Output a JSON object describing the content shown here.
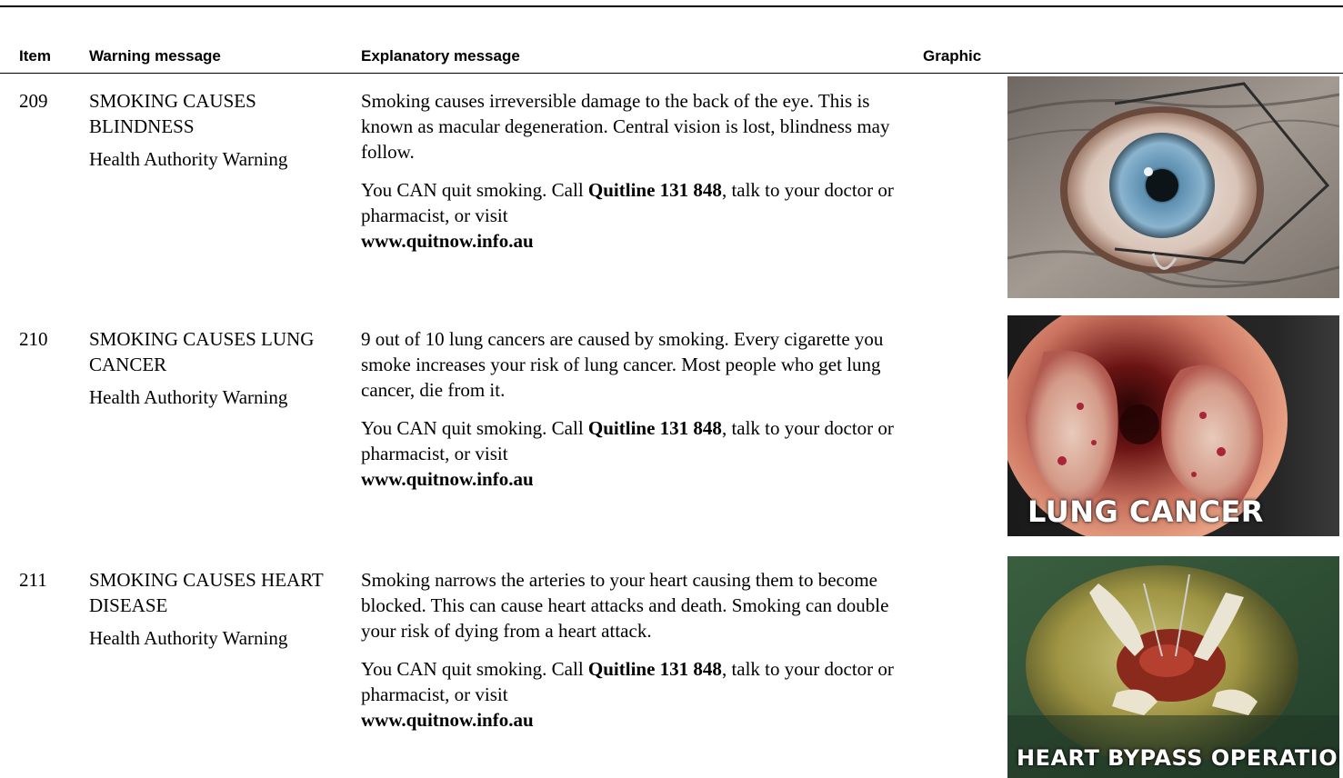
{
  "columns": {
    "item": "Item",
    "warning": "Warning message",
    "explanatory": "Explanatory message",
    "graphic": "Graphic"
  },
  "rows": [
    {
      "item": "209",
      "warning": "SMOKING CAUSES BLINDNESS",
      "authority": "Health Authority Warning",
      "explanation": "Smoking causes irreversible damage to the back of the eye. This is known as macular degeneration. Central vision is lost, blindness may follow.",
      "quit_prefix": "You CAN quit smoking. Call ",
      "quitline": "Quitline 131 848",
      "quit_suffix": ", talk to your doctor or pharmacist, or visit",
      "url": "www.quitnow.info.au",
      "graphic_caption": ""
    },
    {
      "item": "210",
      "warning": "SMOKING CAUSES LUNG CANCER",
      "authority": "Health Authority Warning",
      "explanation": "9 out of 10 lung cancers are caused by smoking. Every cigarette you smoke increases your risk of lung cancer. Most people who get lung cancer, die from it.",
      "quit_prefix": "You CAN quit smoking. Call ",
      "quitline": "Quitline 131 848",
      "quit_suffix": ", talk to your doctor or pharmacist, or visit",
      "url": "www.quitnow.info.au",
      "graphic_caption": "LUNG CANCER"
    },
    {
      "item": "211",
      "warning": "SMOKING CAUSES HEART DISEASE",
      "authority": "Health Authority Warning",
      "explanation": "Smoking narrows the arteries to your heart causing them to become blocked. This can cause heart attacks and death. Smoking can double your risk of dying from a heart attack.",
      "quit_prefix": "You CAN quit smoking. Call ",
      "quitline": "Quitline 131 848",
      "quit_suffix": ", talk to your doctor or pharmacist, or visit",
      "url": "www.quitnow.info.au",
      "graphic_caption": "HEART BYPASS OPERATION"
    }
  ]
}
